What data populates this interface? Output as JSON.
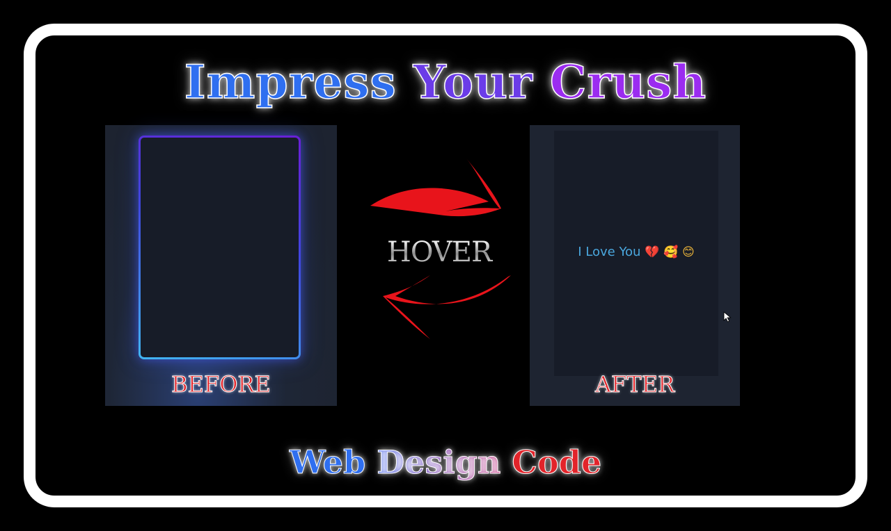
{
  "title": {
    "words": [
      "Impress",
      "Your",
      "Crush"
    ],
    "colors": [
      "#2f6ff0",
      "#6b3ce8",
      "#9b2cf0"
    ]
  },
  "before_panel": {
    "label": "BEFORE",
    "neon_colors": [
      "#6a1fd6",
      "#3f47e0",
      "#41b6f2"
    ]
  },
  "hover": {
    "label": "HOVER",
    "arrow_color": "#e8141b"
  },
  "after_panel": {
    "label": "AFTER",
    "message": "I Love You",
    "emojis": [
      "💔",
      "🥰",
      "😊"
    ],
    "cursor_icon": "pointer-cursor-icon"
  },
  "footer": {
    "words": [
      "Web",
      "Design",
      "Code"
    ],
    "colors": [
      "#2f6ff0",
      "#8a33c4",
      "#e2242a"
    ]
  }
}
